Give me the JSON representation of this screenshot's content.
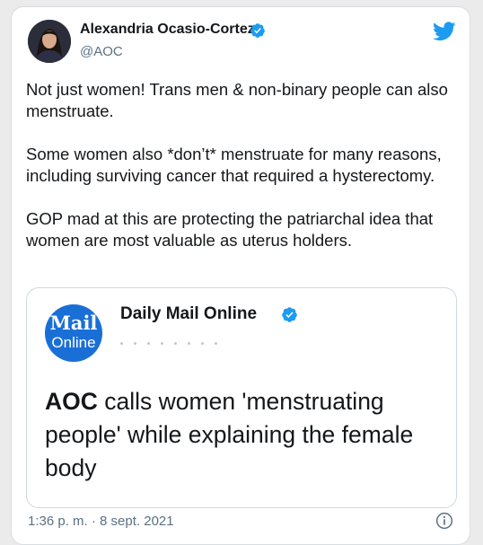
{
  "tweet": {
    "author_name": "Alexandria Ocasio-Cortez",
    "author_handle": "@AOC",
    "paragraphs": [
      "Not just women! Trans men & non-binary people can also menstruate.",
      "Some women also *don’t* menstruate for many reasons, including surviving cancer that required a hysterectomy.",
      "GOP mad at this are protecting the patriarchal idea that women are most valuable as uterus holders."
    ],
    "timestamp": "1:36 p. m. · 8 sept. 2021"
  },
  "quoted": {
    "logo_line1": "Mail",
    "logo_line2": "Online",
    "source_name": "Daily Mail Online",
    "headline_bold": "AOC",
    "headline_rest": " calls women 'menstruating people' while explaining the female body"
  },
  "icons": {
    "verified": "verified-badge-icon",
    "brand": "twitter-bird-icon",
    "info": "info-icon"
  },
  "colors": {
    "twitter_blue": "#1d9bf0",
    "mail_blue": "#1a6fd6",
    "text": "#14171a",
    "muted": "#5b7083"
  }
}
